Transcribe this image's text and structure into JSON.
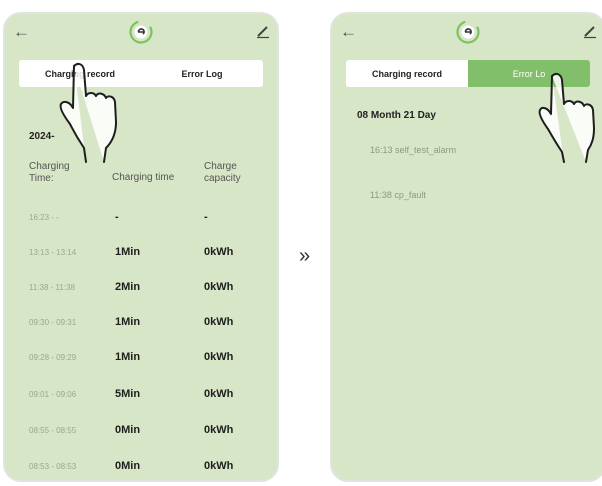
{
  "left_phone": {
    "tabs": [
      "Charging record",
      "Error Log"
    ],
    "active_tab": 0,
    "date": "2024-",
    "headers": {
      "time": "Charging Time:",
      "duration": "Charging time",
      "capacity": "Charge capacity"
    },
    "rows": [
      {
        "time": "16:23 - -",
        "duration": "-",
        "capacity": "-"
      },
      {
        "time": "13:13 - 13:14",
        "duration": "1Min",
        "capacity": "0kWh"
      },
      {
        "time": "11:38 - 11:38",
        "duration": "2Min",
        "capacity": "0kWh"
      },
      {
        "time": "09:30 - 09:31",
        "duration": "1Min",
        "capacity": "0kWh"
      },
      {
        "time": "09:28 - 09:29",
        "duration": "1Min",
        "capacity": "0kWh"
      },
      {
        "time": "09:01 - 09:06",
        "duration": "5Min",
        "capacity": "0kWh"
      },
      {
        "time": "08:55 - 08:55",
        "duration": "0Min",
        "capacity": "0kWh"
      },
      {
        "time": "08:53 - 08:53",
        "duration": "0Min",
        "capacity": "0kWh"
      }
    ]
  },
  "right_phone": {
    "tabs": [
      "Charging record",
      "Error Lo"
    ],
    "active_tab": 1,
    "date": "08 Month 21 Day",
    "errors": [
      {
        "time": "16:13",
        "code": "self_test_alarm"
      },
      {
        "time": "11:38",
        "code": "cp_fault"
      }
    ]
  },
  "transition_symbol": "»",
  "colors": {
    "accent": "#82bf6b",
    "screen_bg": "#d7e6c6"
  }
}
